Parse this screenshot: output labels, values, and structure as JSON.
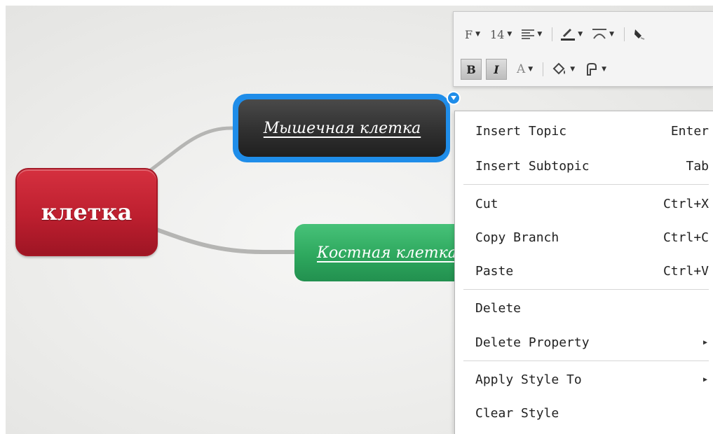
{
  "mindmap": {
    "central_topic": "клетка",
    "subtopics": [
      {
        "label": "Мышечная клетка",
        "color": "#2f2f2f",
        "selected": true
      },
      {
        "label": "Костная клетка",
        "color": "#2ea85e",
        "selected": false
      }
    ],
    "central_color": "#bd1f2f",
    "selection_color": "#1f8de9"
  },
  "toolbar": {
    "font_label": "F",
    "font_size": "14",
    "bold_label": "B",
    "italic_label": "I",
    "font_color_label": "A",
    "icons": [
      "align-icon",
      "line-color-icon",
      "line-shape-icon",
      "clear-format-icon",
      "fill-color-icon",
      "shape-icon"
    ]
  },
  "context_menu": {
    "items": [
      {
        "label": "Insert Topic",
        "shortcut": "Enter"
      },
      {
        "label": "Insert Subtopic",
        "shortcut": "Tab"
      },
      {
        "label": "Cut",
        "shortcut": "Ctrl+X"
      },
      {
        "label": "Copy Branch",
        "shortcut": "Ctrl+C"
      },
      {
        "label": "Paste",
        "shortcut": "Ctrl+V"
      },
      {
        "label": "Delete",
        "shortcut": ""
      },
      {
        "label": "Delete Property",
        "shortcut": "",
        "submenu": true
      },
      {
        "label": "Apply Style To",
        "shortcut": "",
        "submenu": true
      },
      {
        "label": "Clear Style",
        "shortcut": ""
      }
    ]
  }
}
